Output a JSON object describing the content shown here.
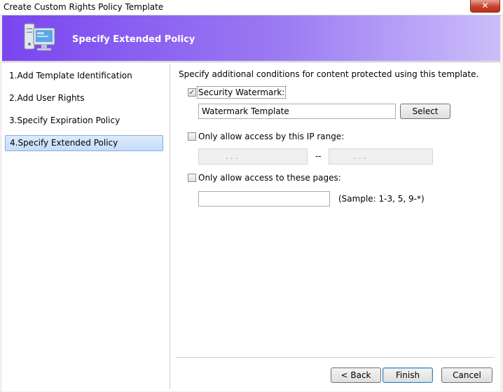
{
  "window": {
    "title": "Create Custom Rights Policy Template",
    "close_glyph": "✕"
  },
  "banner": {
    "title": "Specify Extended Policy",
    "icon": "computer-monitor-icon"
  },
  "steps": [
    {
      "label": "1.Add Template Identification"
    },
    {
      "label": "2.Add User Rights"
    },
    {
      "label": "3.Specify Expiration Policy"
    },
    {
      "label": "4.Specify Extended Policy",
      "active": true
    }
  ],
  "content": {
    "intro": "Specify additional conditions for content protected using this template.",
    "watermark": {
      "checked": true,
      "label": "Security Watermark:",
      "value": "Watermark Template",
      "select_button": "Select"
    },
    "ip_range": {
      "checked": false,
      "label": "Only allow access by this IP range:",
      "separator": "--",
      "dots": ".    .    ."
    },
    "pages": {
      "checked": false,
      "label": "Only allow access to these pages:",
      "value": "",
      "sample": "(Sample: 1-3, 5, 9-*)"
    }
  },
  "footer": {
    "back": "< Back",
    "finish": "Finish",
    "cancel": "Cancel"
  }
}
